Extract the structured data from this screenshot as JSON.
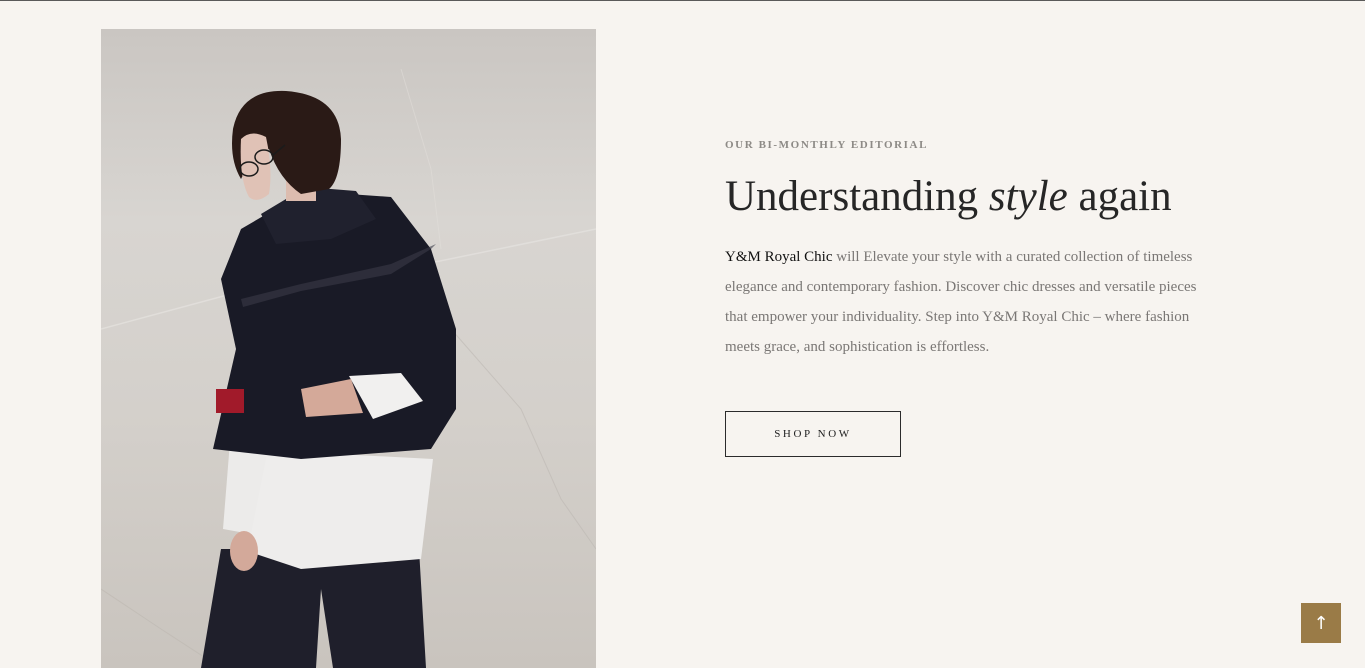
{
  "hero": {
    "image_alt": "model-wearing-navy-cape-jacket",
    "eyebrow": "OUR BI-MONTHLY EDITORIAL",
    "headline_before": "Understanding ",
    "headline_italic": "style",
    "headline_after": " again",
    "brand_name": "Y&M Royal Chic",
    "body_rest": " will Elevate your style with a curated collection of timeless elegance and contemporary fashion. Discover chic dresses and versatile pieces that empower your individuality. Step into Y&M Royal Chic – where fashion meets grace, and sophistication is effortless.",
    "cta_label": "SHOP NOW"
  },
  "scroll_top": {
    "icon": "arrow-up-icon",
    "glyph": "↑"
  },
  "colors": {
    "background": "#f7f4f0",
    "accent": "#9a7b47",
    "heading": "#262626",
    "body_text": "#7a7775"
  }
}
